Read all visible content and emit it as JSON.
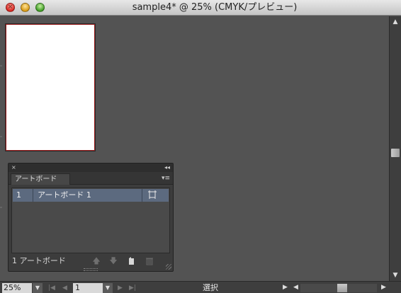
{
  "window": {
    "title": "sample4* @ 25% (CMYK/プレビュー)"
  },
  "artboards_panel": {
    "close_glyph": "×",
    "collapse_glyph": "◂◂",
    "tab_label": "アートボード",
    "menu_glyph": "▾≡",
    "rows": [
      {
        "number": "1",
        "name": "アートボード 1"
      }
    ],
    "footer_count": "1 アートボード"
  },
  "status_bar": {
    "zoom_value": "25%",
    "page_value": "1",
    "status_text": "選択"
  },
  "colors": {
    "canvas": "#535353",
    "artboard_border": "#9a1a1a",
    "selected_row": "#5c6a7f"
  }
}
